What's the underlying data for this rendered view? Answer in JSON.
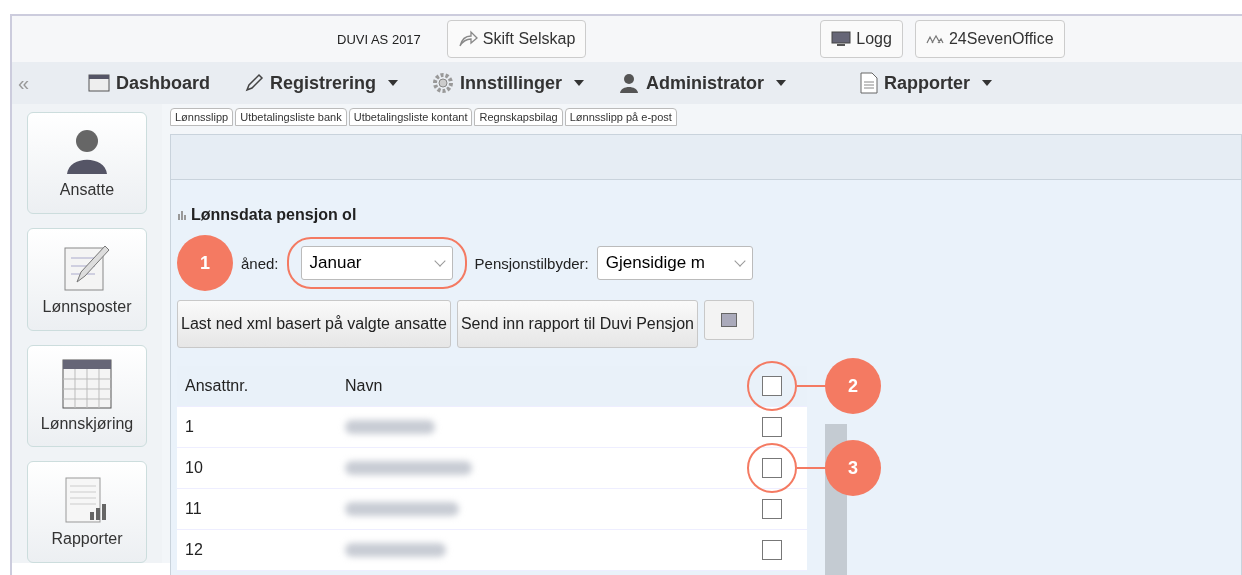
{
  "top_bar": {
    "company": "DUVI AS  2017",
    "switch_button": "Skift Selskap",
    "log_button": "Logg",
    "brand_button": "24SevenOffice"
  },
  "nav": {
    "collapse": "«",
    "items": [
      {
        "label": "Dashboard",
        "kind": "calendar",
        "dropdown": false
      },
      {
        "label": "Registrering",
        "kind": "pencil",
        "dropdown": true
      },
      {
        "label": "Innstillinger",
        "kind": "gear",
        "dropdown": true
      },
      {
        "label": "Administrator",
        "kind": "person",
        "dropdown": true
      },
      {
        "label": "Rapporter",
        "kind": "document",
        "dropdown": true
      }
    ]
  },
  "sidebar": {
    "items": [
      {
        "label": "Ansatte",
        "kind": "person"
      },
      {
        "label": "Lønnsposter",
        "kind": "pencil"
      },
      {
        "label": "Lønnskjøring",
        "kind": "calendar"
      },
      {
        "label": "Rapporter",
        "kind": "chart"
      }
    ]
  },
  "tabs": [
    "Lønnsslipp",
    "Utbetalingsliste bank",
    "Utbetalingsliste kontant",
    "Regnskapsbilag",
    "Lønnsslipp på e-post"
  ],
  "section_title": "Lønnsdata pensjon ol",
  "month": {
    "label": "åned:",
    "value": "Januar",
    "callout": "1"
  },
  "provider": {
    "label": "Pensjonstilbyder:",
    "value": "Gjensidige m"
  },
  "buttons": [
    "Last ned xml basert på valgte ansatte",
    "Send inn rapport til Duvi Pensjon"
  ],
  "table": {
    "columns": [
      "Ansattnr.",
      "Navn"
    ],
    "header_checked": false,
    "header_callout": "2",
    "rows": [
      {
        "number": "1",
        "checked": false,
        "callout": ""
      },
      {
        "number": "10",
        "checked": false,
        "callout": "3"
      },
      {
        "number": "11",
        "checked": false,
        "callout": ""
      },
      {
        "number": "12",
        "checked": false,
        "callout": ""
      }
    ]
  }
}
